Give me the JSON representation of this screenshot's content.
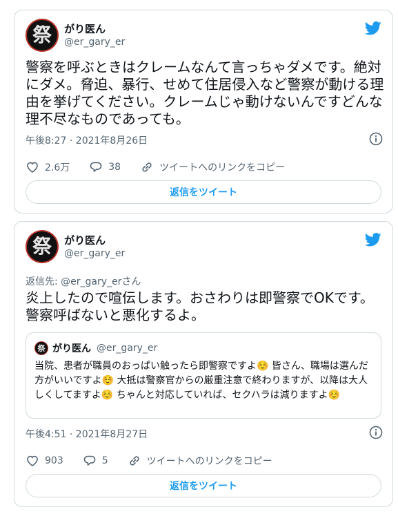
{
  "tweets": [
    {
      "author": {
        "name": "がり医ん",
        "handle": "@er_gary_er",
        "avatar_glyph": "祭"
      },
      "text": "警察を呼ぶときはクレームなんて言っちゃダメです。絶対にダメ。脅迫、暴行、せめて住居侵入など警察が動ける理由を挙げてください。クレームじゃ動けないんですどんな理不尽なものであっても。",
      "timestamp": "午後8:27 · 2021年8月26日",
      "likes": "2.6万",
      "replies": "38",
      "copy_link_label": "ツイートへのリンクをコピー",
      "reply_button_label": "返信をツイート"
    },
    {
      "author": {
        "name": "がり医ん",
        "handle": "@er_gary_er",
        "avatar_glyph": "祭"
      },
      "reply_to": "返信先: @er_gary_erさん",
      "text_lines": [
        "炎上したので喧伝します。おさわりは即警察でOKです。",
        "警察呼ばないと悪化するよ。"
      ],
      "quote": {
        "name": "がり医ん",
        "handle": "@er_gary_er",
        "avatar_glyph": "祭",
        "text": "当院、患者が職員のおっぱい触ったら即警察ですよ☺️ 皆さん、職場は選んだ方がいいですよ☺️ 大抵は警察官からの厳重注意で終わりますが、以降は大人しくしてますよ☺️ ちゃんと対応していれば、セクハラは減りますよ☺️"
      },
      "timestamp": "午後4:51 · 2021年8月27日",
      "likes": "903",
      "replies": "5",
      "copy_link_label": "ツイートへのリンクをコピー",
      "reply_button_label": "返信をツイート"
    }
  ],
  "colors": {
    "twitter_blue": "#1d9bf0",
    "secondary_text": "#536471",
    "border": "#cfd9de"
  },
  "icons": [
    "twitter-bird-icon",
    "info-icon",
    "heart-icon",
    "reply-bubble-icon",
    "link-icon"
  ]
}
